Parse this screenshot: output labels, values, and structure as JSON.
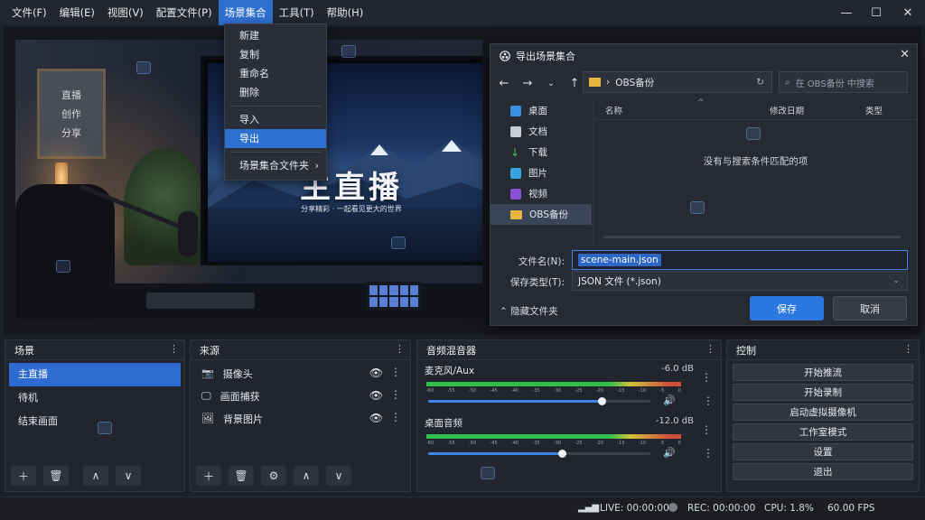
{
  "menubar": {
    "items": [
      "文件(F)",
      "编辑(E)",
      "视图(V)",
      "配置文件(P)",
      "场景集合",
      "工具(T)",
      "帮助(H)"
    ],
    "active_index": 4
  },
  "dropdown": {
    "items": [
      "新建",
      "复制",
      "重命名",
      "删除",
      "导入",
      "导出",
      "场景集合文件夹"
    ],
    "highlighted": "导出"
  },
  "preview": {
    "poster_lines": [
      "直播",
      "创作",
      "分享"
    ],
    "screen_title": "主直播",
    "screen_subtitle": "分享精彩 · 一起看见更大的世界"
  },
  "dialog": {
    "title": "导出场景集合",
    "path": "OBS备份",
    "search_placeholder": "在 OBS备份 中搜索",
    "nav": [
      "桌面",
      "文档",
      "下载",
      "图片",
      "视频",
      "OBS备份"
    ],
    "columns": [
      "名称",
      "修改日期",
      "类型"
    ],
    "empty_message": "没有与搜索条件匹配的项",
    "filename_label": "文件名(N):",
    "filename_value": "scene-main.json",
    "filetype_label": "保存类型(T):",
    "filetype_value": "JSON 文件 (*.json)",
    "hide_folders": "隐藏文件夹",
    "save": "保存",
    "cancel": "取消"
  },
  "scenes": {
    "title": "场景",
    "items": [
      "主直播",
      "待机",
      "结束画面"
    ],
    "selected": "主直播"
  },
  "sources": {
    "title": "来源",
    "items": [
      "摄像头",
      "画面捕获",
      "背景图片"
    ]
  },
  "mixer": {
    "title": "音频混音器",
    "tracks": [
      {
        "name": "麦克风/Aux",
        "db": "-6.0 dB",
        "level": 0.78
      },
      {
        "name": "桌面音频",
        "db": "-12.0 dB",
        "level": 0.6
      }
    ],
    "ticks": [
      "-60",
      "-55",
      "-50",
      "-45",
      "-40",
      "-35",
      "-30",
      "-25",
      "-20",
      "-15",
      "-10",
      "-5",
      "0"
    ]
  },
  "controls": {
    "title": "控制",
    "buttons": [
      "开始推流",
      "开始录制",
      "启动虚拟摄像机",
      "工作室模式",
      "设置",
      "退出"
    ]
  },
  "status": {
    "live": "LIVE: 00:00:00",
    "rec": "REC: 00:00:00",
    "cpu": "CPU: 1.8%",
    "fps": "60.00 FPS"
  },
  "icons": [
    "search-icon",
    "refresh-icon",
    "folder-icon",
    "camera-icon",
    "monitor-icon",
    "image-icon",
    "eye-icon",
    "speaker-icon",
    "gear-icon",
    "signal-icon"
  ]
}
